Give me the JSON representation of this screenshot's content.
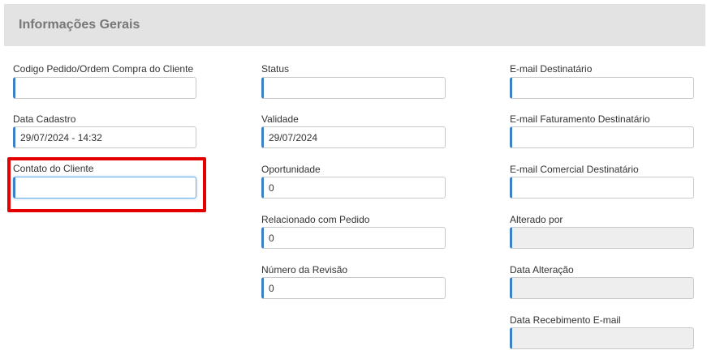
{
  "panel": {
    "title": "Informações Gerais"
  },
  "fields": {
    "codigo_pedido": {
      "label": "Codigo Pedido/Ordem Compra do Cliente",
      "value": ""
    },
    "data_cadastro": {
      "label": "Data Cadastro",
      "value": "29/07/2024 - 14:32"
    },
    "contato_cliente": {
      "label": "Contato do Cliente",
      "value": ""
    },
    "status": {
      "label": "Status",
      "value": ""
    },
    "validade": {
      "label": "Validade",
      "value": "29/07/2024"
    },
    "oportunidade": {
      "label": "Oportunidade",
      "value": "0"
    },
    "relacionado_pedido": {
      "label": "Relacionado com Pedido",
      "value": "0"
    },
    "numero_revisao": {
      "label": "Número da Revisão",
      "value": "0"
    },
    "email_destinatario": {
      "label": "E-mail Destinatário",
      "value": ""
    },
    "email_faturamento": {
      "label": "E-mail Faturamento Destinatário",
      "value": ""
    },
    "email_comercial": {
      "label": "E-mail Comercial Destinatário",
      "value": ""
    },
    "alterado_por": {
      "label": "Alterado por",
      "value": ""
    },
    "data_alteracao": {
      "label": "Data Alteração",
      "value": ""
    },
    "data_recebimento_email": {
      "label": "Data Recebimento E-mail",
      "value": ""
    }
  },
  "colors": {
    "accent": "#3c80c6",
    "highlight": "#e30000",
    "header_bg": "#e3e3e3",
    "disabled_bg": "#eeeeee"
  }
}
